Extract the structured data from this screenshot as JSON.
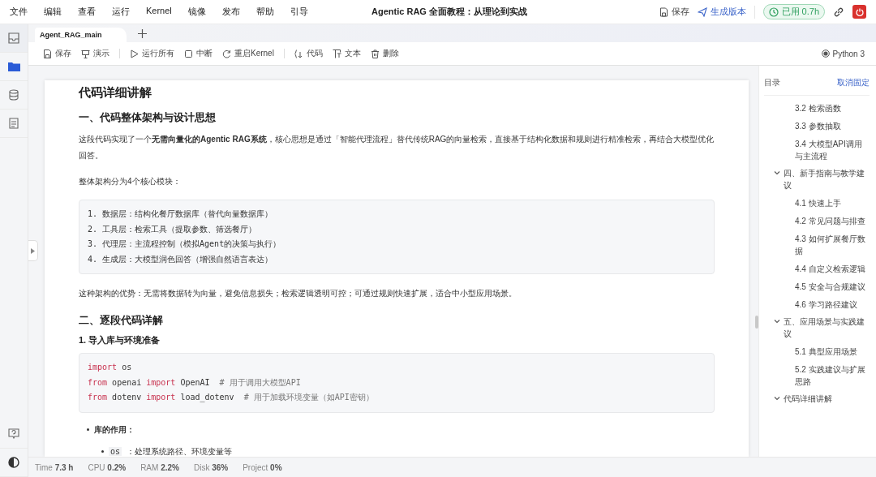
{
  "menu": [
    "文件",
    "编辑",
    "查看",
    "运行",
    "Kernel",
    "镜像",
    "发布",
    "帮助",
    "引导"
  ],
  "title": "Agentic RAG 全面教程：从理论到实战",
  "header_actions": {
    "save": "保存",
    "publish": "生成版本",
    "usage": "已用 0.7h"
  },
  "tabs": [
    {
      "label": "Agent_RAG_main",
      "selected": true
    }
  ],
  "toolbar": [
    "保存",
    "演示",
    "运行所有",
    "中断",
    "重启Kernel",
    "代码",
    "文本",
    "删除"
  ],
  "kernel": "Python 3",
  "doc": [
    {
      "kind": "h1",
      "text": "代码详细讲解"
    },
    {
      "kind": "h2",
      "text": "一、代码整体架构与设计思想"
    },
    {
      "kind": "p",
      "text": "这段代码实现了一个**无需向量化的Agentic RAG系统**，核心思想是通过「智能代理流程」替代传统RAG的向量检索，直接基于结构化数据和规则进行精准检索，再结合大模型优化回答。"
    },
    {
      "kind": "p",
      "text": "整体架构分为4个核心模块："
    },
    {
      "kind": "pre",
      "lines": [
        [
          {
            "s": "1. 数据层：结构化餐厅数据库（替代向量数据库）"
          }
        ],
        [
          {
            "s": "2. 工具层：检索工具（提取参数、筛选餐厅）"
          }
        ],
        [
          {
            "s": "3. 代理层：主流程控制（模拟Agent的决策与执行）"
          }
        ],
        [
          {
            "s": "4. 生成层：大模型润色回答（增强自然语言表达）"
          }
        ]
      ]
    },
    {
      "kind": "p",
      "text": "这种架构的优势：无需将数据转为向量，避免信息损失；检索逻辑透明可控；可通过规则快速扩展，适合中小型应用场景。"
    },
    {
      "kind": "h2",
      "text": "二、逐段代码详解"
    },
    {
      "kind": "h3",
      "text": "1. 导入库与环境准备"
    },
    {
      "kind": "pre",
      "lines": [
        [
          {
            "kind": "keyword",
            "s": "import"
          },
          {
            "s": " os"
          }
        ],
        [
          {
            "kind": "keyword",
            "s": "from"
          },
          {
            "s": " openai "
          },
          {
            "kind": "keyword",
            "s": "import"
          },
          {
            "s": " OpenAI  "
          },
          {
            "kind": "comment",
            "s": "# 用于调用大模型API"
          }
        ],
        [
          {
            "kind": "keyword",
            "s": "from"
          },
          {
            "s": " dotenv "
          },
          {
            "kind": "keyword",
            "s": "import"
          },
          {
            "s": " load_dotenv  "
          },
          {
            "kind": "comment",
            "s": "# 用于加载环境变量（如API密钥）"
          }
        ]
      ]
    },
    {
      "kind": "bullet",
      "text": "库的作用：",
      "children": [
        {
          "code": "os",
          "text": "：处理系统路径、环境变量等"
        }
      ]
    }
  ],
  "toc": {
    "title": "目录",
    "unpin": "取消固定",
    "items": [
      {
        "children": [
          {
            "label": "3.2 检索函数"
          },
          {
            "label": "3.3 参数抽取"
          },
          {
            "label": "3.4 大模型API调用与主流程"
          }
        ]
      },
      {
        "label": "四、新手指南与教学建议",
        "expanded": true,
        "children": [
          {
            "label": "4.1 快速上手"
          },
          {
            "label": "4.2 常见问题与排查"
          },
          {
            "label": "4.3 如何扩展餐厅数据"
          },
          {
            "label": "4.4 自定义检索逻辑"
          },
          {
            "label": "4.5 安全与合规建议"
          },
          {
            "label": "4.6 学习路径建议"
          }
        ]
      },
      {
        "label": "五、应用场景与实践建议",
        "expanded": true,
        "children": [
          {
            "label": "5.1 典型应用场景"
          },
          {
            "label": "5.2 实践建议与扩展思路"
          }
        ]
      },
      {
        "label": "代码详细讲解",
        "expanded": true
      }
    ]
  },
  "status": [
    {
      "label": "Time",
      "value": "7.3 h"
    },
    {
      "label": "CPU",
      "value": "0.2%"
    },
    {
      "label": "RAM",
      "value": "2.2%"
    },
    {
      "label": "Disk",
      "value": "36%"
    },
    {
      "label": "Project",
      "value": "0%"
    }
  ]
}
